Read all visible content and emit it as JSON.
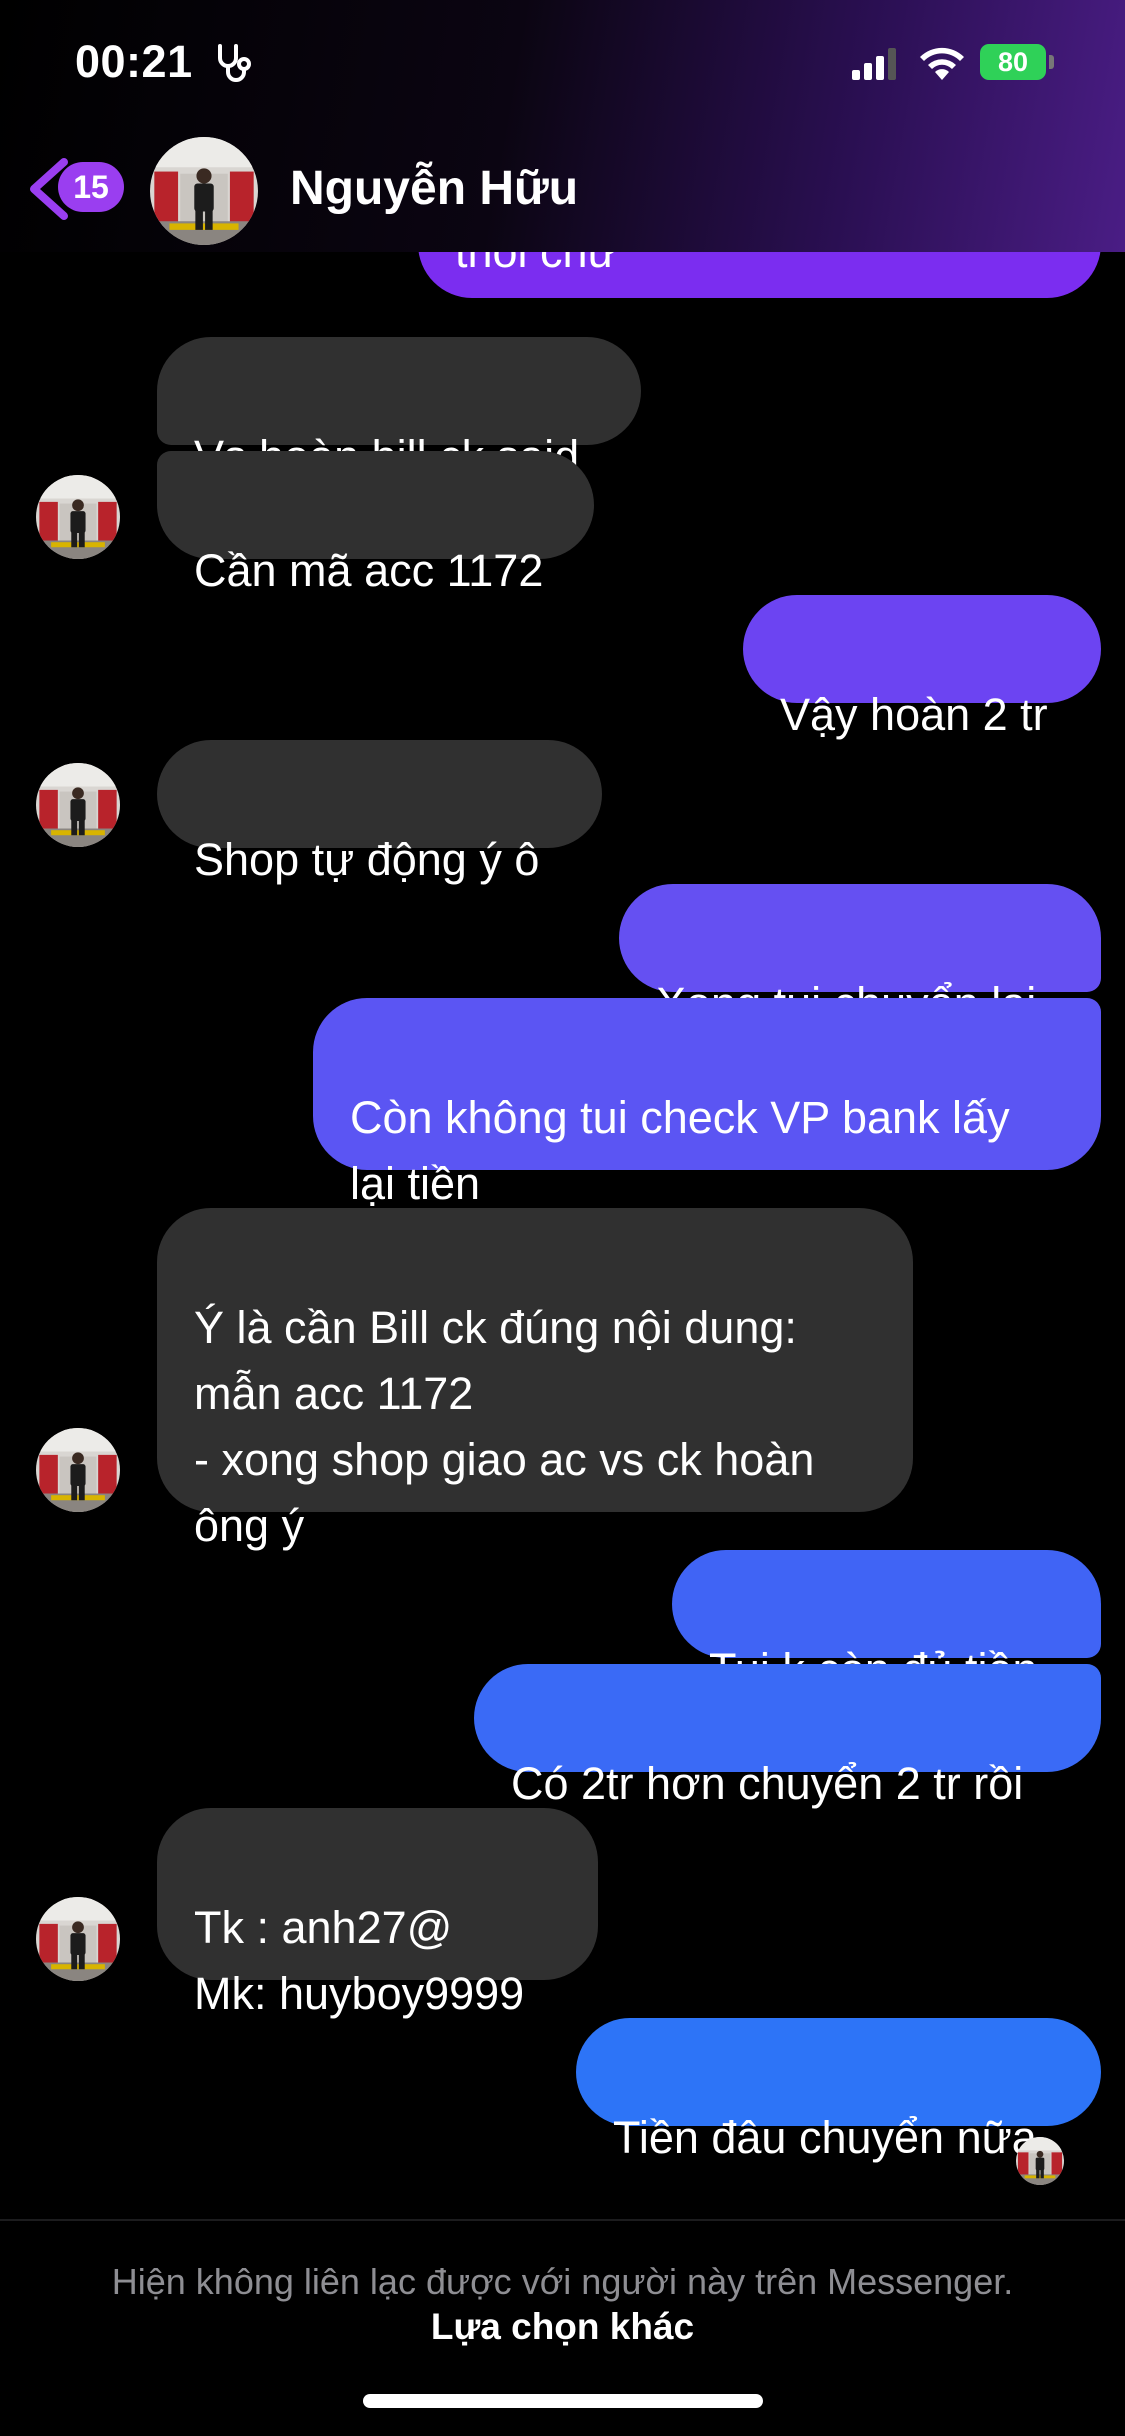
{
  "status_bar": {
    "time": "00:21",
    "battery": "80"
  },
  "header": {
    "unread_count": "15",
    "contact_name": "Nguyễn Hữu"
  },
  "messages": [
    {
      "side": "out",
      "text": "thôi chứ"
    },
    {
      "side": "in",
      "text": "Vs hoàn bill ck said"
    },
    {
      "side": "in",
      "text": "Cần mã acc 1172"
    },
    {
      "side": "out",
      "text": "Vậy hoàn 2 tr"
    },
    {
      "side": "in",
      "text": "Shop tự động ý ô"
    },
    {
      "side": "out",
      "text": "Xong tui chuyển lại"
    },
    {
      "side": "out",
      "text": "Còn không tui check VP bank lấy\nlại tiền"
    },
    {
      "side": "in",
      "text": "Ý là cần Bill ck đúng nội dung:\nmẫn acc 1172\n- xong shop giao ac vs ck hoàn\nông ý"
    },
    {
      "side": "out",
      "text": "Tui k còn đủ tiền"
    },
    {
      "side": "out",
      "text": "Có 2tr hơn chuyển 2 tr rồi"
    },
    {
      "side": "in",
      "text": "Tk : anh27@\nMk: huyboy9999"
    },
    {
      "side": "out",
      "text": "Tiền đâu chuyển nữa"
    }
  ],
  "footer": {
    "notice": "Hiện không liên lạc được với người này trên Messenger.",
    "link": "Lựa chọn khác"
  },
  "colors": {
    "incoming_bubble": "#303030",
    "outgoing_gradient": [
      "#8a33f2",
      "#7b2df0",
      "#5e54f3",
      "#3a6cf6",
      "#2d74f7"
    ],
    "badge": "#9a3ef0",
    "battery": "#2fd158"
  }
}
